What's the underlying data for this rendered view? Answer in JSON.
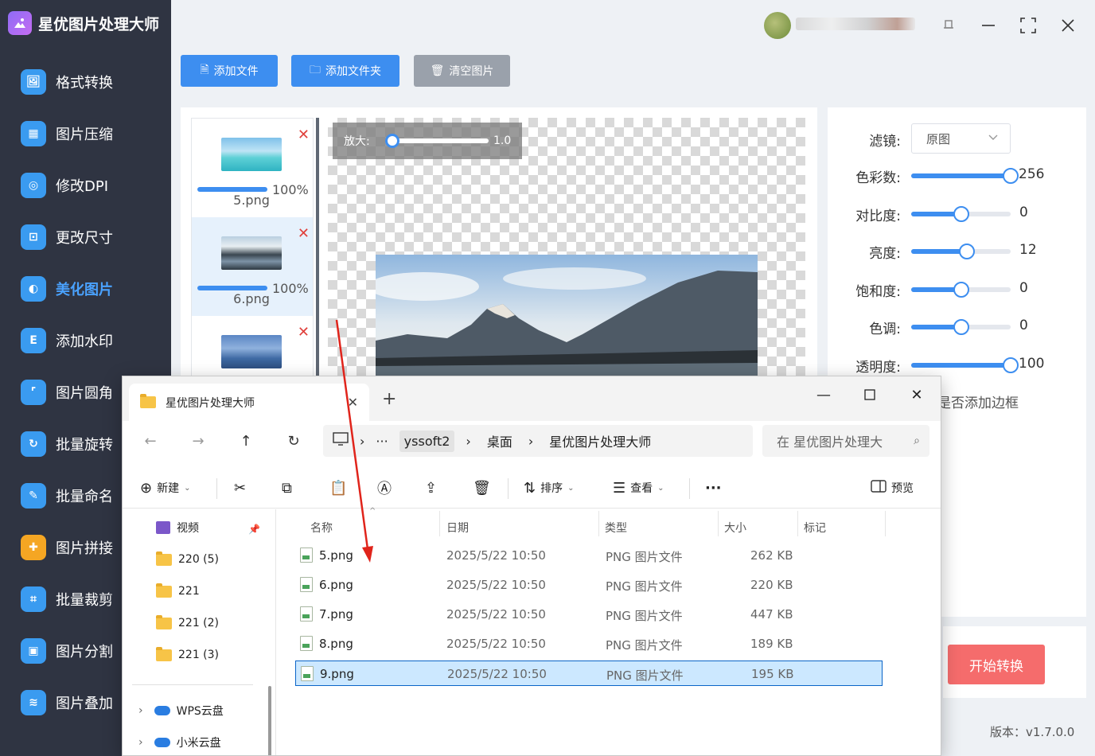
{
  "app": {
    "title": "星优图片处理大师"
  },
  "sidebar": {
    "items": [
      {
        "label": "格式转换",
        "icon": "image-convert-icon",
        "color": "#3a9bf0"
      },
      {
        "label": "图片压缩",
        "icon": "compress-icon",
        "color": "#3a9bf0"
      },
      {
        "label": "修改DPI",
        "icon": "dpi-icon",
        "color": "#3a9bf0"
      },
      {
        "label": "更改尺寸",
        "icon": "resize-icon",
        "color": "#3a9bf0"
      },
      {
        "label": "美化图片",
        "icon": "beautify-icon",
        "color": "#3a9bf0"
      },
      {
        "label": "添加水印",
        "icon": "watermark-icon",
        "color": "#3a9bf0"
      },
      {
        "label": "图片圆角",
        "icon": "round-corner-icon",
        "color": "#3a9bf0"
      },
      {
        "label": "批量旋转",
        "icon": "rotate-icon",
        "color": "#3a9bf0"
      },
      {
        "label": "批量命名",
        "icon": "rename-icon",
        "color": "#3a9bf0"
      },
      {
        "label": "图片拼接",
        "icon": "puzzle-icon",
        "color": "#f5a623"
      },
      {
        "label": "批量裁剪",
        "icon": "crop-icon",
        "color": "#3a9bf0"
      },
      {
        "label": "图片分割",
        "icon": "split-icon",
        "color": "#3a9bf0"
      },
      {
        "label": "图片叠加",
        "icon": "layers-icon",
        "color": "#3a9bf0"
      }
    ],
    "active_index": 4
  },
  "toolbar": {
    "add_file": "添加文件",
    "add_folder": "添加文件夹",
    "clear": "清空图片"
  },
  "thumbnails": [
    {
      "name": "5.png",
      "progress": "100%"
    },
    {
      "name": "6.png",
      "progress": "100%"
    },
    {
      "name": "",
      "progress": ""
    }
  ],
  "preview": {
    "zoom_label": "放大:",
    "zoom_value": "1.0",
    "zoom_fraction": 0.0
  },
  "adjustments": {
    "filter_label": "滤镜:",
    "filter_value": "原图",
    "sliders": [
      {
        "label": "色彩数:",
        "value": "256",
        "fraction": 1.0
      },
      {
        "label": "对比度:",
        "value": "0",
        "fraction": 0.5
      },
      {
        "label": "亮度:",
        "value": "12",
        "fraction": 0.56
      },
      {
        "label": "饱和度:",
        "value": "0",
        "fraction": 0.5
      },
      {
        "label": "色调:",
        "value": "0",
        "fraction": 0.5
      },
      {
        "label": "透明度:",
        "value": "100",
        "fraction": 1.0
      }
    ],
    "border_label": "是否添加边框"
  },
  "actions": {
    "start": "开始转换"
  },
  "footer": {
    "version": "版本：v1.7.0.0"
  },
  "explorer": {
    "tab_title": "星优图片处理大师",
    "address": {
      "root": "yssoft2",
      "desktop": "桌面",
      "folder": "星优图片处理大师",
      "ellipsis": "···"
    },
    "search_placeholder": "在 星优图片处理大",
    "commands": {
      "new": "新建",
      "sort": "排序",
      "view": "查看",
      "more": "···",
      "preview": "预览"
    },
    "left_nav": [
      {
        "label": "视频",
        "icon": "video-folder-icon"
      },
      {
        "label": "220 (5)",
        "icon": "folder-icon"
      },
      {
        "label": "221",
        "icon": "folder-icon"
      },
      {
        "label": "221 (2)",
        "icon": "folder-icon"
      },
      {
        "label": "221 (3)",
        "icon": "folder-icon"
      },
      {
        "label": "WPS云盘",
        "icon": "cloud-icon"
      },
      {
        "label": "小米云盘",
        "icon": "cloud-icon"
      }
    ],
    "columns": {
      "name": "名称",
      "date": "日期",
      "type": "类型",
      "size": "大小",
      "tag": "标记"
    },
    "files": [
      {
        "name": "5.png",
        "date": "2025/5/22 10:50",
        "type": "PNG 图片文件",
        "size": "262 KB"
      },
      {
        "name": "6.png",
        "date": "2025/5/22 10:50",
        "type": "PNG 图片文件",
        "size": "220 KB"
      },
      {
        "name": "7.png",
        "date": "2025/5/22 10:50",
        "type": "PNG 图片文件",
        "size": "447 KB"
      },
      {
        "name": "8.png",
        "date": "2025/5/22 10:50",
        "type": "PNG 图片文件",
        "size": "189 KB"
      },
      {
        "name": "9.png",
        "date": "2025/5/22 10:50",
        "type": "PNG 图片文件",
        "size": "195 KB"
      }
    ],
    "selected_index": 4
  },
  "colors": {
    "accent": "#3d8ef0",
    "danger": "#f56c6c",
    "sidebar": "#2f3442",
    "arrow": "#e0241b"
  }
}
